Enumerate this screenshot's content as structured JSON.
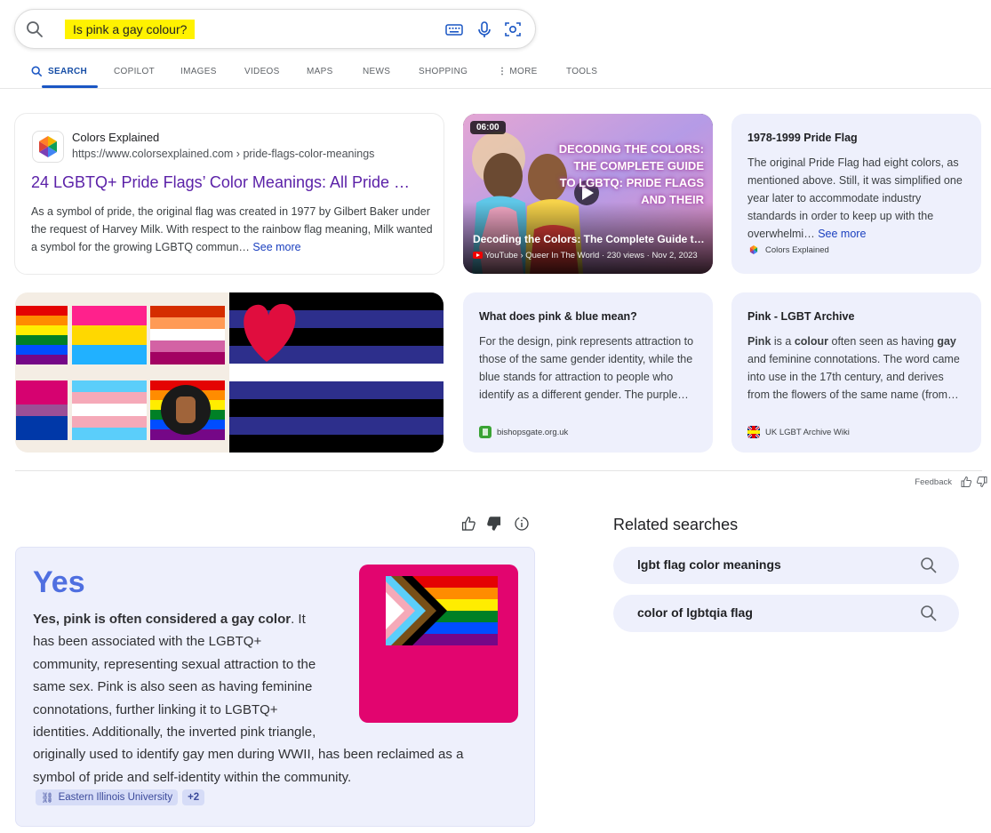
{
  "search": {
    "query": "Is pink a gay colour?"
  },
  "tabs": [
    {
      "label": "SEARCH"
    },
    {
      "label": "COPILOT"
    },
    {
      "label": "IMAGES"
    },
    {
      "label": "VIDEOS"
    },
    {
      "label": "MAPS"
    },
    {
      "label": "NEWS"
    },
    {
      "label": "SHOPPING"
    },
    {
      "label": "MORE"
    },
    {
      "label": "TOOLS"
    }
  ],
  "result1": {
    "site": "Colors Explained",
    "url": "https://www.colorsexplained.com › pride-flags-color-meanings",
    "title": "24 LGBTQ+ Pride Flags’ Color Meanings: All Pride …",
    "snippet": "As a symbol of pride, the original flag was created in 1977 by Gilbert Baker under the request of Harvey Milk. With respect to the rainbow flag meaning, Milk wanted a symbol for the growing LGBTQ commun…",
    "see_more": "See more"
  },
  "video": {
    "duration": "06:00",
    "overlay_text": "DECODING THE COLORS: THE COMPLETE GUIDE TO LGBTQ: PRIDE FLAGS AND THEIR",
    "title": "Decoding the Colors: The Complete Guide t…",
    "meta": "YouTube › Queer In The World · 230 views · Nov 2, 2023"
  },
  "card_flag": {
    "title": "1978-1999 Pride Flag",
    "text": "The original Pride Flag had eight colors, as mentioned above. Still, it was simplified one year later to accommodate industry standards in order to keep up with the overwhelmi…",
    "see_more": "See more",
    "source": "Colors Explained"
  },
  "card_pinkblue": {
    "title": "What does pink & blue mean?",
    "text": "For the design, pink represents attraction to those of the same gender identity, while the blue stands for attraction to people who identify as a different gender. The purple…",
    "source": "bishopsgate.org.uk"
  },
  "card_archive": {
    "title": "Pink - LGBT Archive",
    "text_pre": "Pink",
    "text_mid1": " is a ",
    "text_bold2": "colour",
    "text_mid2": " often seen as having ",
    "text_bold3": "gay",
    "text_rest": " and feminine connotations. The word came into use in the 17th century, and derives from the flowers of the same name (from…",
    "source": "UK LGBT Archive Wiki"
  },
  "feedback": {
    "label": "Feedback"
  },
  "answer": {
    "headline": "Yes",
    "bold": "Yes, pink is often considered a gay color",
    "text": ". It has been associated with the LGBTQ+ community, representing sexual attraction to the same sex. Pink is also seen as having feminine connotations, further linking it to LGBTQ+ identities. Additionally, the inverted pink triangle, originally used to identify gay men during WWII, has been reclaimed as a symbol of pride and self-identity within the community.",
    "citation": "Eastern Illinois University",
    "more_sources": "+2"
  },
  "related": {
    "heading": "Related searches",
    "items": [
      {
        "label": "lgbt flag color meanings"
      },
      {
        "label": "color of lgbtqia flag"
      }
    ]
  },
  "colors": {
    "accent": "#1a56c4",
    "answer_bg": "#eef0fc",
    "yes": "#4f6fe0",
    "highlight": "#fff200",
    "flag_bg": "#e2056f"
  }
}
